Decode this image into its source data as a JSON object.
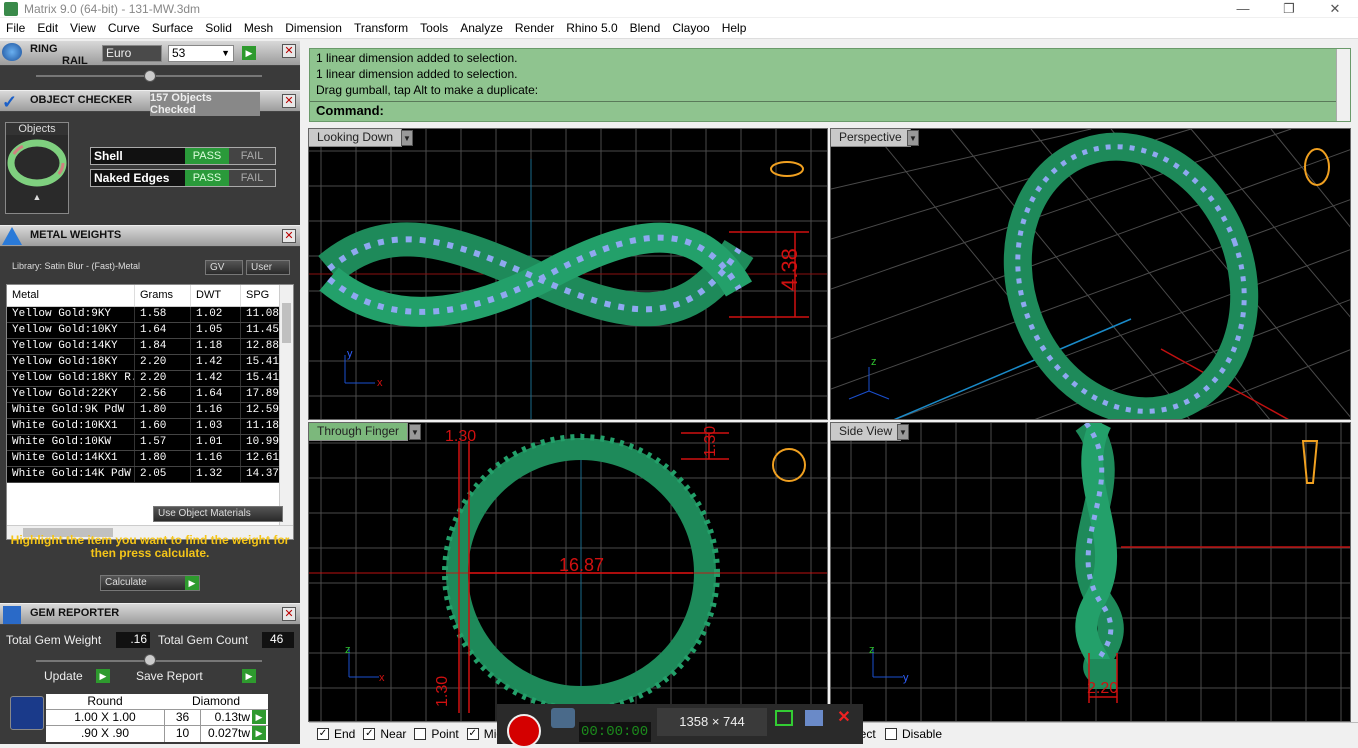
{
  "window": {
    "title": "Matrix 9.0 (64-bit) - 131-MW.3dm"
  },
  "menu": [
    "File",
    "Edit",
    "View",
    "Curve",
    "Surface",
    "Solid",
    "Mesh",
    "Dimension",
    "Transform",
    "Tools",
    "Analyze",
    "Render",
    "Rhino 5.0",
    "Blend",
    "Clayoo",
    "Help"
  ],
  "ring_rail": {
    "title_line1": "RING",
    "title_line2": "RAIL",
    "standard": "Euro",
    "size": "53"
  },
  "object_checker": {
    "title": "OBJECT CHECKER",
    "status": "157 Objects Checked",
    "objects_label": "Objects",
    "checks": [
      {
        "label": "Shell",
        "pass": "PASS",
        "fail": "FAIL"
      },
      {
        "label": "Naked Edges",
        "pass": "PASS",
        "fail": "FAIL"
      }
    ]
  },
  "metal_weights": {
    "title": "METAL WEIGHTS",
    "library": "Library: Satin Blur - (Fast)-Metal",
    "gv_label": "GV",
    "user_label": "User",
    "columns": [
      "Metal",
      "Grams",
      "DWT",
      "SPG"
    ],
    "rows": [
      [
        "Yellow Gold:9KY",
        "1.58",
        "1.02",
        "11.08"
      ],
      [
        "Yellow Gold:10KY",
        "1.64",
        "1.05",
        "11.45"
      ],
      [
        "Yellow Gold:14KY",
        "1.84",
        "1.18",
        "12.88"
      ],
      [
        "Yellow Gold:18KY",
        "2.20",
        "1.42",
        "15.41"
      ],
      [
        "Yellow Gold:18KY R...",
        "2.20",
        "1.42",
        "15.41"
      ],
      [
        "Yellow Gold:22KY",
        "2.56",
        "1.64",
        "17.89"
      ],
      [
        "White Gold:9K PdW",
        "1.80",
        "1.16",
        "12.59"
      ],
      [
        "White Gold:10KX1",
        "1.60",
        "1.03",
        "11.18"
      ],
      [
        "White Gold:10KW",
        "1.57",
        "1.01",
        "10.99"
      ],
      [
        "White Gold:14KX1",
        "1.80",
        "1.16",
        "12.61"
      ],
      [
        "White Gold:14K PdW",
        "2.05",
        "1.32",
        "14.37"
      ]
    ],
    "use_object_materials": "Use Object Materials",
    "hint": "Highlight the item you want to find the weight for then press calculate.",
    "calculate": "Calculate"
  },
  "gem_reporter": {
    "title": "GEM REPORTER",
    "total_weight_label": "Total Gem Weight",
    "total_weight": ".16",
    "total_count_label": "Total Gem Count",
    "total_count": "46",
    "update": "Update",
    "save_report": "Save Report",
    "table_headers": [
      "Round",
      "Diamond"
    ],
    "rows": [
      [
        "1.00 X 1.00",
        "36",
        "0.13tw"
      ],
      [
        ".90 X .90",
        "10",
        "0.027tw"
      ]
    ]
  },
  "command": {
    "lines": [
      "1 linear dimension added to selection.",
      "1 linear dimension added to selection.",
      "Drag gumball, tap Alt to make a duplicate:"
    ],
    "prompt": "Command:"
  },
  "viewports": [
    {
      "name": "Looking Down",
      "dimension": "4.38"
    },
    {
      "name": "Perspective"
    },
    {
      "name": "Through Finger",
      "dim_a": "1.30",
      "dim_b": "1.30",
      "dim_c": "16.87",
      "dim_d": "1.30"
    },
    {
      "name": "Side View",
      "dimension": "2.20"
    }
  ],
  "osnaps": [
    {
      "label": "End",
      "checked": true
    },
    {
      "label": "Near",
      "checked": true
    },
    {
      "label": "Point",
      "checked": false
    },
    {
      "label": "Mid",
      "checked": true
    }
  ],
  "osnap_right": {
    "partial": "ject",
    "disable": "Disable"
  },
  "recorder": {
    "timer": "00:00:00",
    "dims": "1358 × 744"
  },
  "colors": {
    "model": "#1e8a5a",
    "gems": "#8fa8f0",
    "grid": "#555555",
    "dimension": "#d01010"
  }
}
